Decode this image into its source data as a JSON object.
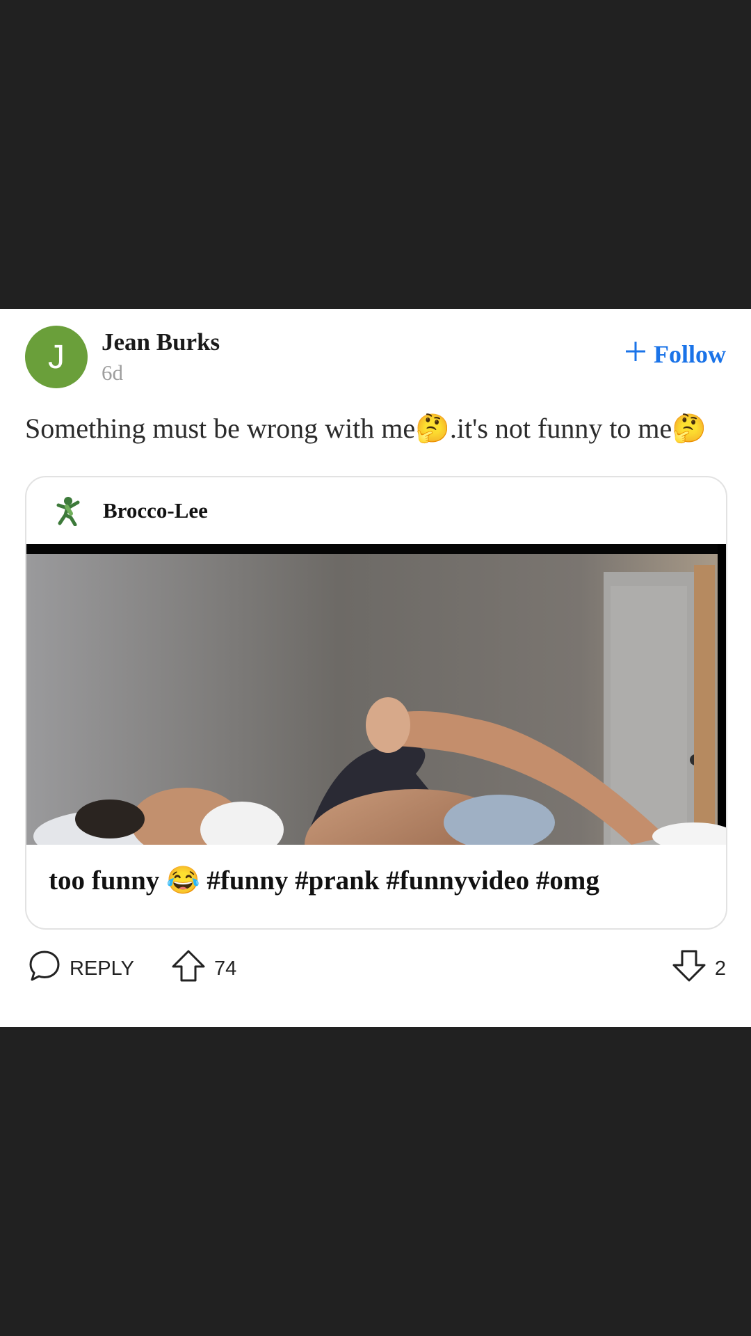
{
  "post": {
    "author": {
      "initial": "J",
      "name": "Jean Burks",
      "time": "6d",
      "avatar_color": "#6a9f3a"
    },
    "follow_label": "Follow",
    "text": "Something must be wrong with me🤔.it's not funny to me🤔",
    "embed": {
      "author": "Brocco-Lee",
      "caption": "too funny 😂 #funny #prank #funnyvideo #omg"
    },
    "actions": {
      "reply_label": "REPLY",
      "upvotes": "74",
      "downvotes": "2"
    }
  },
  "colors": {
    "background": "#212121",
    "accent": "#1a73e8",
    "muted": "#9e9e9e"
  }
}
